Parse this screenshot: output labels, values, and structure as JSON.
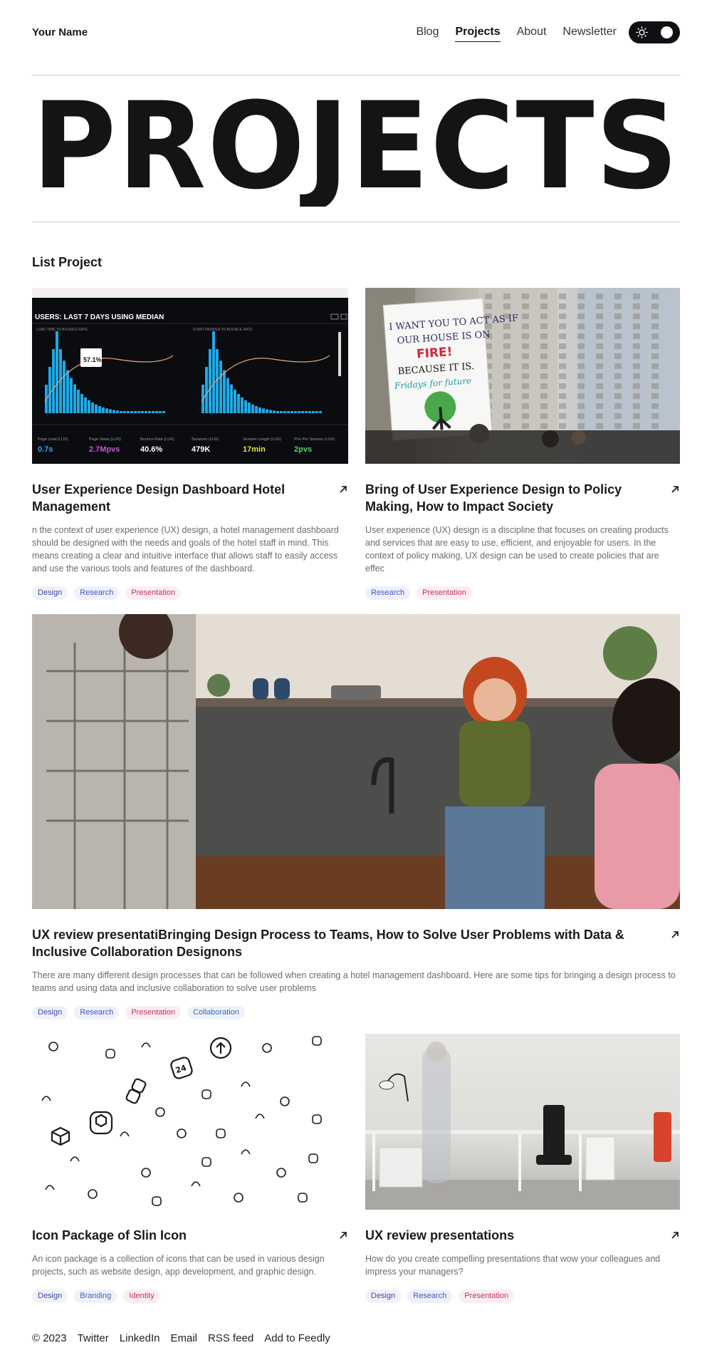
{
  "header": {
    "brand": "Your Name",
    "nav": [
      "Blog",
      "Projects",
      "About",
      "Newsletter"
    ],
    "active_nav": "Projects"
  },
  "hero": {
    "title": "PROJECTS"
  },
  "section": {
    "title": "List Project"
  },
  "cards": [
    {
      "title": "User Experience Design Dashboard Hotel Management",
      "description": "n the context of user experience (UX) design, a hotel management dashboard should be designed with the needs and goals of the hotel staff in mind. This means creating a clear and intuitive interface that allows staff to easily access and use the various tools and features of the dashboard.",
      "tags": [
        "Design",
        "Research",
        "Presentation"
      ],
      "image": {
        "header": "USERS: LAST 7 DAYS USING MEDIAN",
        "chart_left_label": "LOAD TIME VS BOUNCE RATE",
        "chart_right_label": "START RENDER VS BOUNCE RATE",
        "callout": "57.1%",
        "metrics": [
          {
            "label": "Page Load (LUX)",
            "value": "0.7s"
          },
          {
            "label": "Page Views (LUX)",
            "value": "2.7Mpvs"
          },
          {
            "label": "Bounce Rate (LUX)",
            "value": "40.6%"
          },
          {
            "label": "Sessions (LUX)",
            "value": "479K"
          },
          {
            "label": "Session Length (LUX)",
            "value": "17min"
          },
          {
            "label": "PVs Per Session (LUX)",
            "value": "2pvs"
          }
        ]
      }
    },
    {
      "title": "Bring of User Experience Design to Policy Making, How to Impact Society",
      "description": "User experience (UX) design is a discipline that focuses on creating products and services that are easy to use, efficient, and enjoyable for users. In the context of policy making, UX design can be used to create policies that are effec",
      "tags": [
        "Research",
        "Presentation"
      ],
      "image": {
        "sign_lines": [
          "I WANT YOU TO ACT AS IF",
          "OUR HOUSE IS ON",
          "FIRE!",
          "BECAUSE IT IS.",
          "Fridays for future"
        ]
      }
    },
    {
      "title": "UX review presentatiBringing Design Process to Teams, How to Solve User Problems with Data & Inclusive Collaboration Designons",
      "description": "There are many different design processes that can be followed when creating a hotel management dashboard. Here are some tips for bringing a design process to teams and using data and inclusive collaboration to solve user problems",
      "tags": [
        "Design",
        "Research",
        "Presentation",
        "Collaboration"
      ]
    },
    {
      "title": "Icon Package of Slin Icon",
      "description": "An icon package is a collection of icons that can be used in various design projects, such as website design, app development, and graphic design.",
      "tags": [
        "Design",
        "Branding",
        "Identity"
      ],
      "image": {
        "badge": "24"
      }
    },
    {
      "title": "UX review presentations",
      "description": "How do you create compelling presentations that wow your colleagues and impress your managers?",
      "tags": [
        "Design",
        "Research",
        "Presentation"
      ]
    }
  ],
  "footer": {
    "copyright": "© 2023",
    "links": [
      "Twitter",
      "LinkedIn",
      "Email",
      "RSS feed",
      "Add to Feedly"
    ]
  },
  "colors": {
    "text": "#1a1a1a",
    "muted": "#6b6b6b",
    "rule": "#c9c9c9",
    "toggle_bg": "#0f0f14",
    "dashboard_accent": "#1fa9e6"
  }
}
